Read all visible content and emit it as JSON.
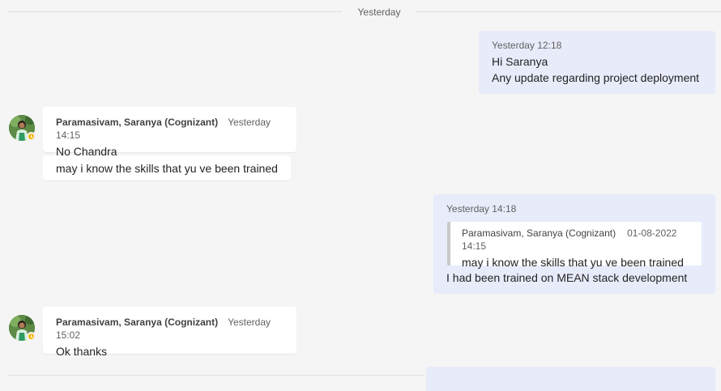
{
  "divider": {
    "label": "Yesterday"
  },
  "messages": [
    {
      "direction": "outgoing",
      "timestamp": "Yesterday 12:18",
      "lines": [
        "Hi Saranya",
        "Any update regarding project deployment"
      ]
    },
    {
      "direction": "incoming",
      "sender": "Paramasivam, Saranya (Cognizant)",
      "timestamp": "Yesterday 14:15",
      "text": "No Chandra",
      "followup": "may i know the skills that yu ve been trained",
      "avatar": "avatar-photo",
      "status_icon": "clock-away-icon"
    },
    {
      "direction": "outgoing",
      "timestamp": "Yesterday 14:18",
      "quote": {
        "sender": "Paramasivam, Saranya (Cognizant)",
        "timestamp": "01-08-2022 14:15",
        "text": "may i know the skills that yu ve been trained"
      },
      "text": "I had been trained on MEAN stack development"
    },
    {
      "direction": "incoming",
      "sender": "Paramasivam, Saranya (Cognizant)",
      "timestamp": "Yesterday 15:02",
      "text": "Ok thanks",
      "avatar": "avatar-photo",
      "status_icon": "clock-away-icon"
    }
  ],
  "colors": {
    "background": "#f5f5f5",
    "outgoing_bubble": "#e8ebfa",
    "incoming_bubble": "#ffffff",
    "away_status": "#f4b400"
  }
}
